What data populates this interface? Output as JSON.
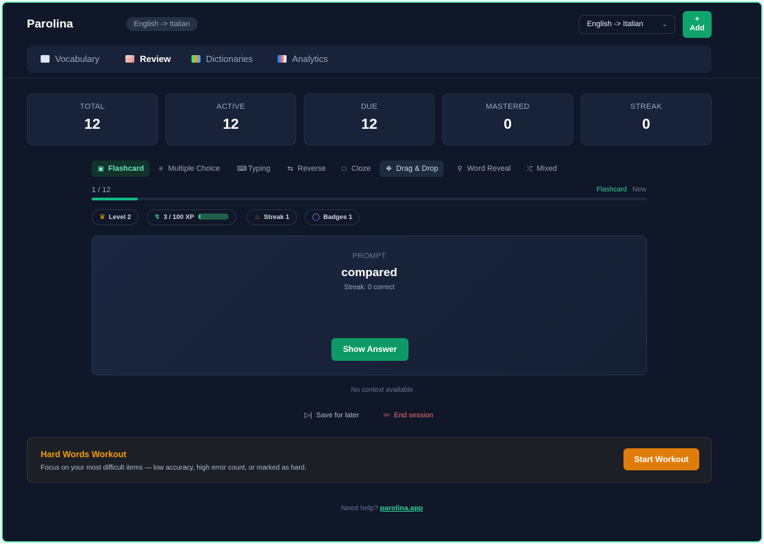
{
  "app": {
    "brand": "Parolina",
    "lang_pill": "English -> Italian",
    "lang_select": "English -> Italian",
    "add_plus": "+",
    "add_label": "Add"
  },
  "nav": [
    {
      "label": "Vocabulary",
      "icon": "book-icon",
      "active": false
    },
    {
      "label": "Review",
      "icon": "notebook-icon",
      "active": true
    },
    {
      "label": "Dictionaries",
      "icon": "books-icon",
      "active": false
    },
    {
      "label": "Analytics",
      "icon": "bar-chart-icon",
      "active": false
    }
  ],
  "stats": [
    {
      "label": "TOTAL",
      "value": "12"
    },
    {
      "label": "ACTIVE",
      "value": "12"
    },
    {
      "label": "DUE",
      "value": "12"
    },
    {
      "label": "MASTERED",
      "value": "0"
    },
    {
      "label": "STREAK",
      "value": "0"
    }
  ],
  "modes": [
    {
      "label": "Flashcard",
      "icon": "open-book-icon"
    },
    {
      "label": "Multiple Choice",
      "icon": "list-check-icon"
    },
    {
      "label": "Typing",
      "icon": "keyboard-icon"
    },
    {
      "label": "Reverse",
      "icon": "arrows-swap-icon"
    },
    {
      "label": "Cloze",
      "icon": "document-icon"
    },
    {
      "label": "Drag & Drop",
      "icon": "move-icon"
    },
    {
      "label": "Word Reveal",
      "icon": "search-icon"
    },
    {
      "label": "Mixed",
      "icon": "shuffle-icon"
    }
  ],
  "progress": {
    "count": "1 / 12",
    "mode": "Flashcard",
    "state": "New",
    "fraction": 0.083
  },
  "chips": {
    "level": "Level 2",
    "xp": "3 / 100 XP",
    "xp_fraction": 0.03,
    "streak": "Streak 1",
    "badges": "Badges 1"
  },
  "card": {
    "prompt_label": "PROMPT",
    "word": "compared",
    "streak_text": "Streak: 0 correct",
    "show_answer": "Show Answer"
  },
  "context": "No context available",
  "actions": {
    "save": "Save for later",
    "end": "End session"
  },
  "workout": {
    "title": "Hard Words Workout",
    "description": "Focus on your most difficult items — low accuracy, high error count, or marked as hard.",
    "button": "Start Workout"
  },
  "footer": {
    "text": "Need help?",
    "link": "parolina.app"
  },
  "colors": {
    "background": "#0f1729",
    "accent": "#10b981",
    "workout_accent": "#f59e0b",
    "danger": "#f87171"
  }
}
